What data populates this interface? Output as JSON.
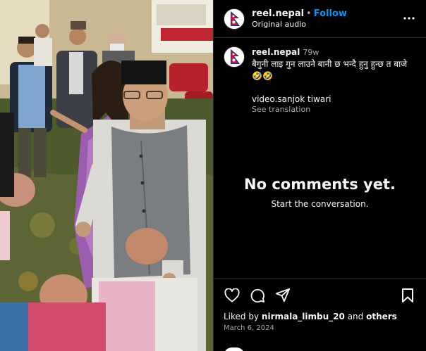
{
  "post": {
    "username": "reel.nepal",
    "follow_label": "Follow",
    "separator": "•",
    "audio_label": "Original audio",
    "caption": {
      "username": "reel.nepal",
      "age": "79w",
      "text": "बैगुनी लाइ गुन लाउने बानी छ भन्दै हुनु हुन्छ त बाजे 🤣🤣",
      "credit": "video.sanjok tiwari",
      "translate_label": "See translation"
    },
    "comments": {
      "empty_title": "No comments yet.",
      "empty_subtitle": "Start the conversation."
    },
    "likes": {
      "prefix": "Liked by",
      "user": "nirmala_limbu_20",
      "joiner": "and",
      "others": "others"
    },
    "date": "March 6, 2024"
  },
  "icons": {
    "more": "more-options-icon",
    "like": "heart-icon",
    "comment": "comment-icon",
    "share": "share-icon",
    "save": "bookmark-icon",
    "avatar": "nepal-flag-avatar"
  },
  "colors": {
    "background": "#000000",
    "link": "#0095f6",
    "muted": "#a8a8a8",
    "divider": "#262626",
    "flag_red": "#dc143c",
    "flag_blue": "#003893"
  }
}
